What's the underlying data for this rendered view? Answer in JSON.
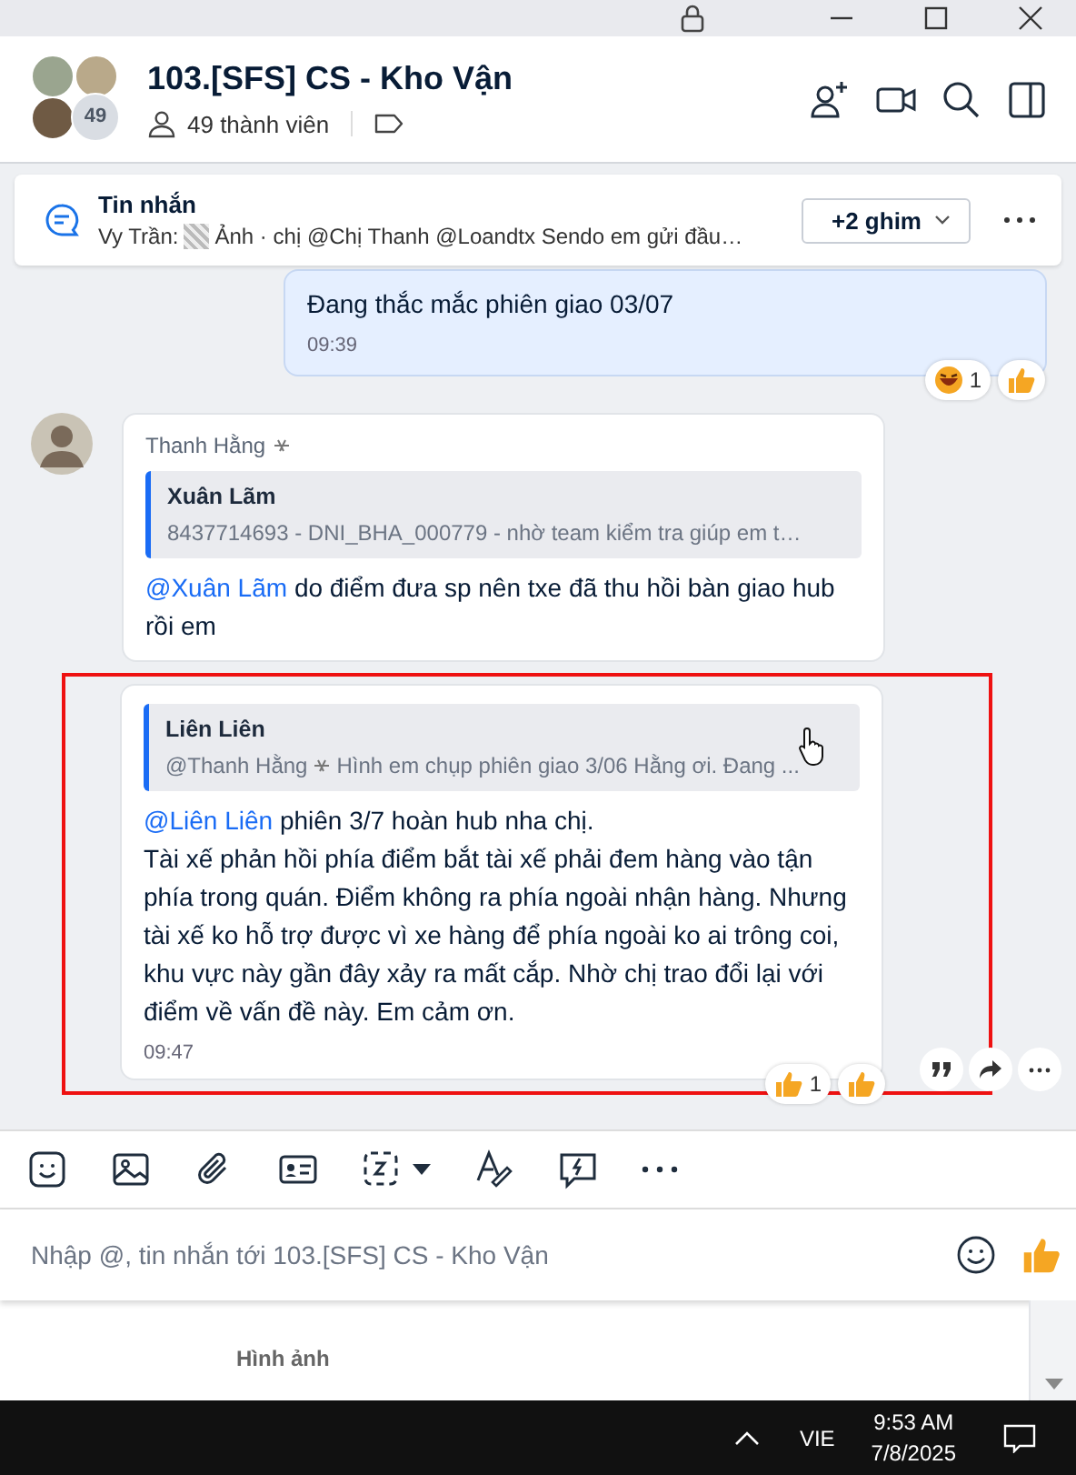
{
  "header": {
    "title": "103.[SFS] CS - Kho Vận",
    "member_count": "49",
    "members": "49 thành viên"
  },
  "pinned": {
    "title": "Tin nhắn",
    "sender": "Vy Trần:",
    "preview": "Ảnh · chị @Chị Thanh @Loandtx Sendo em gửi đầu…",
    "pins_button": "+2 ghim"
  },
  "messages": [
    {
      "kind": "outgoing",
      "text": "Đang thắc mắc phiên giao 03/07",
      "time": "09:39",
      "reactions": [
        {
          "kind": "laugh",
          "count": "1"
        },
        {
          "kind": "like"
        }
      ]
    },
    {
      "kind": "incoming",
      "sender": "Thanh Hằng",
      "quote": {
        "author": "Xuân Lãm",
        "text": "8437714693 - DNI_BHA_000779 - nhờ team kiểm tra giúp em t…"
      },
      "mention": "@Xuân Lãm",
      "lines": [
        "do điểm đưa sp nên txe đã thu hồi bàn giao hub rồi em"
      ]
    },
    {
      "kind": "incoming",
      "highlighted": true,
      "quote": {
        "author": "Liên Liên",
        "mention": "@Thanh Hằng",
        "text": "Hình em chụp phiên giao 3/06 Hằng ơi. Đang ..."
      },
      "mention": "@Liên Liên",
      "lines": [
        "phiên 3/7 hoàn hub nha chị.",
        "Tài xế phản hồi phía điểm bắt tài xế phải đem hàng vào tận phía trong quán. Điểm không ra phía ngoài nhận hàng. Nhưng tài xế ko hỗ trợ được vì xe hàng để phía ngoài ko ai trông coi, khu vực này gần đây xảy ra mất cắp. Nhờ chị trao đổi lại với điểm về vấn đề này. Em cảm ơn."
      ],
      "time": "09:47",
      "reactions": [
        {
          "kind": "like",
          "count": "1"
        },
        {
          "kind": "like"
        }
      ]
    }
  ],
  "composer": {
    "placeholder": "Nhập @, tin nhắn tới 103.[SFS] CS - Kho Vận"
  },
  "side_panel": {
    "section": "Hình ảnh"
  },
  "taskbar": {
    "language": "VIE",
    "time": "9:53 AM",
    "date": "7/8/2025"
  }
}
